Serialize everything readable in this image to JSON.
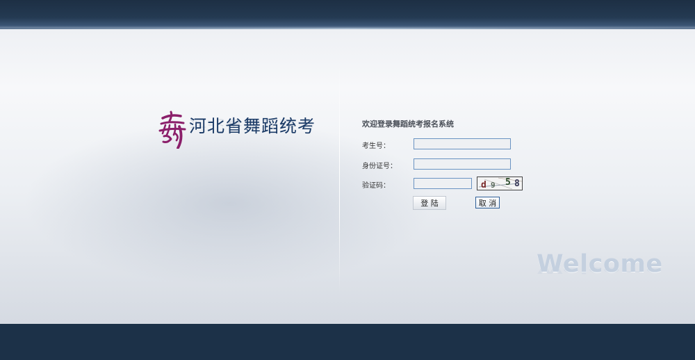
{
  "header": {
    "logo_text": "河北省舞蹈统考"
  },
  "login_form": {
    "title": "欢迎登录舞蹈统考报名系统",
    "candidate_number_label": "考生号：",
    "candidate_number_value": "",
    "id_card_label": "身份证号：",
    "id_card_value": "",
    "captcha_label": "验证码：",
    "captcha_value": "",
    "captcha_characters": [
      "d",
      "9",
      "5",
      "8"
    ],
    "login_button": "登 陆",
    "cancel_button": "取 消"
  },
  "watermark": "Welcome",
  "colors": {
    "top_bar": "#1d2f44",
    "bottom_bar": "#1c3148",
    "logo_text": "#1a3a66",
    "logo_mark": "#8b1f6a",
    "input_border": "#6a93c2"
  },
  "icons": {
    "logo_mark": "dance-calligraphy-logo"
  }
}
